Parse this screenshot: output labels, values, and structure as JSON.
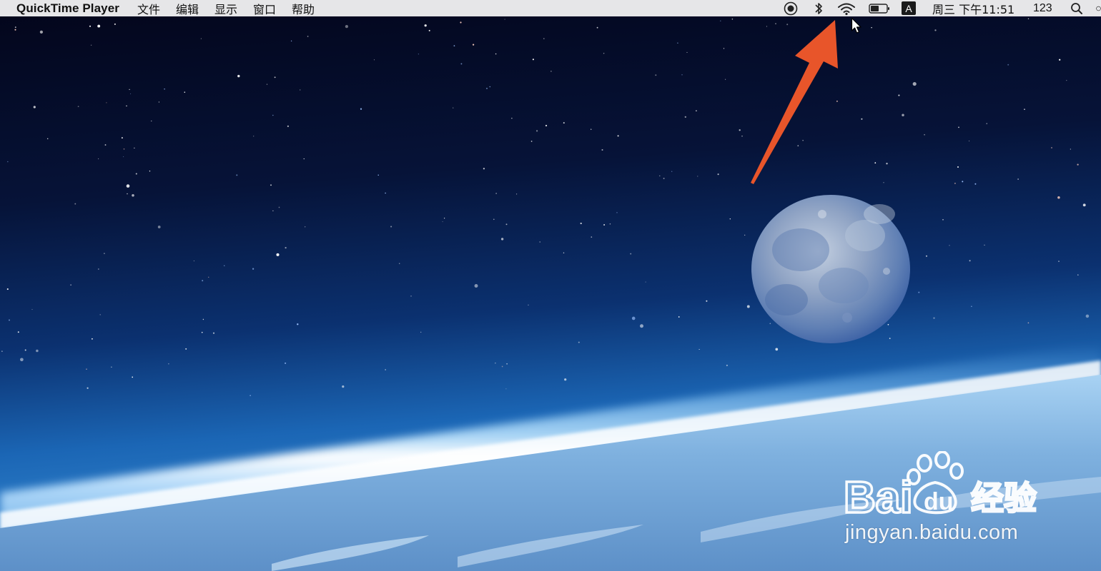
{
  "menubar": {
    "app_name": "QuickTime Player",
    "menus": [
      "文件",
      "编辑",
      "显示",
      "窗口",
      "帮助"
    ]
  },
  "status": {
    "icons": [
      "screen-record-icon",
      "bluetooth-icon",
      "wifi-icon",
      "battery-icon",
      "input-source-icon",
      "search-icon",
      "siri-icon"
    ],
    "input_source_label": "A",
    "clock": "周三 下午11:51",
    "keyboard_label": "123"
  },
  "watermark": {
    "logo_text": "Bai 经验",
    "url": "jingyan.baidu.com"
  },
  "colors": {
    "menubar": "#e6e6e8",
    "arrow": "#e8552a",
    "sky_top": "#05071a",
    "sky_mid": "#0c2e6b",
    "horizon": "#d8f0ff"
  }
}
